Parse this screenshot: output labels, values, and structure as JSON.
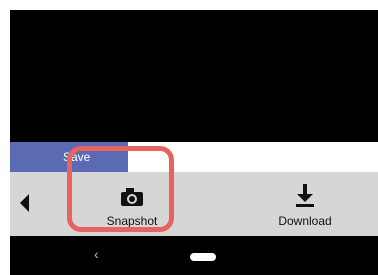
{
  "save_bar": {
    "label": "Save",
    "progress_percent": 32,
    "color": "#5b6bb3"
  },
  "toolbar": {
    "back_icon": "triangle-left-icon",
    "buttons": [
      {
        "icon": "camera-icon",
        "label": "Snapshot"
      },
      {
        "icon": "download-icon",
        "label": "Download"
      }
    ]
  },
  "highlight": {
    "target": "Snapshot",
    "color": "#e8625f"
  },
  "nav_bar": {
    "back_glyph": "‹",
    "home_icon": "home-pill-icon"
  }
}
